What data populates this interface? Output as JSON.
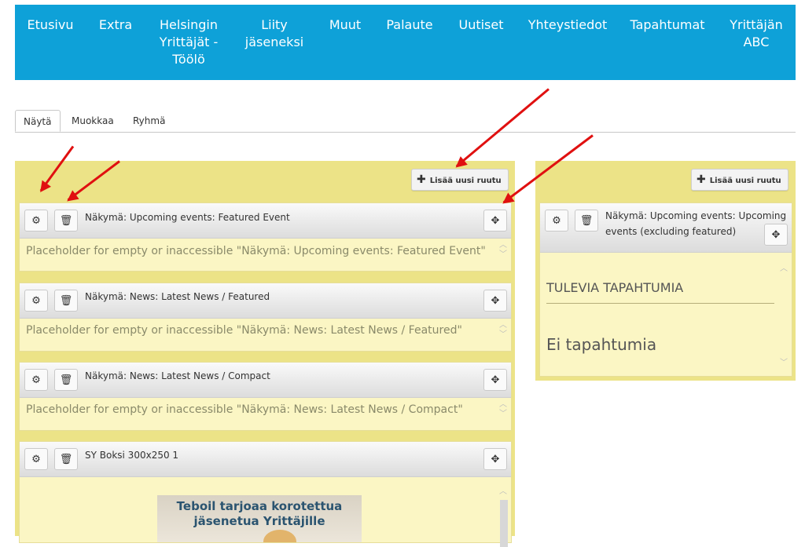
{
  "nav": {
    "items": [
      {
        "label": "Etusivu"
      },
      {
        "label": "Extra"
      },
      {
        "label": "Helsingin\nYrittäjät -\nTöölö"
      },
      {
        "label": "Liity\njäseneksi"
      },
      {
        "label": "Muut"
      },
      {
        "label": "Palaute"
      },
      {
        "label": "Uutiset"
      },
      {
        "label": "Yhteystiedot"
      },
      {
        "label": "Tapahtumat"
      },
      {
        "label": "Yrittäjän\nABC"
      }
    ]
  },
  "tabs": [
    "Näytä",
    "Muokkaa",
    "Ryhmä"
  ],
  "add_pane_label": "Lisää uusi ruutu",
  "panes": [
    {
      "title": "Näkymä: Upcoming events: Featured Event",
      "placeholder": "Placeholder for empty or inaccessible \"Näkymä: Upcoming events: Featured Event\""
    },
    {
      "title": "Näkymä: News: Latest News / Featured",
      "placeholder": "Placeholder for empty or inaccessible \"Näkymä: News: Latest News / Featured\""
    },
    {
      "title": "Näkymä: News: Latest News / Compact",
      "placeholder": "Placeholder for empty or inaccessible \"Näkymä: News: Latest News / Compact\""
    },
    {
      "title": "SY Boksi 300x250 1",
      "ad_text": "Teboil tarjoaa korotettua\njäsenetua Yrittäjille"
    }
  ],
  "side_pane": {
    "title": "Näkymä: Upcoming events: Upcoming\nevents (excluding featured)",
    "heading": "TULEVIA TAPAHTUMIA",
    "empty_text": "Ei tapahtumia"
  },
  "colors": {
    "nav": "#0ea1d8",
    "region": "#ece387",
    "pane": "#fbf6c4",
    "arrow": "#e01010"
  },
  "icons": {
    "configure": "gear-icon",
    "delete": "trash-icon",
    "move": "move-icon",
    "add": "plus-icon",
    "scroll": "scroll-arrow-icon"
  }
}
